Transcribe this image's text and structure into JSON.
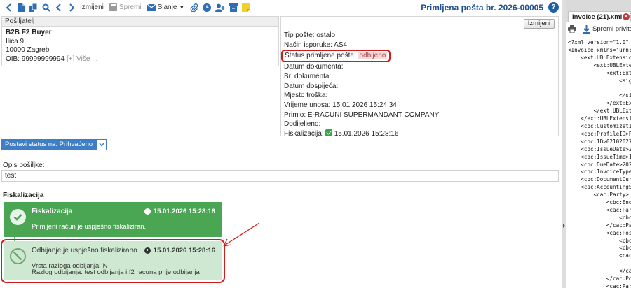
{
  "toolbar": {
    "edit_label": "Izmijeni",
    "save_label": "Spremi",
    "send_label": "Slanje",
    "title": "Primljena pošta br. 2026-00005",
    "help_label": "?"
  },
  "sender": {
    "header": "Pošiljatelj",
    "company": "B2B F2 Buyer",
    "street": "Ilica 9",
    "city": "10000 Zagreb",
    "oib": "OIB: 99999999994",
    "more": "[+] Više ..."
  },
  "info": {
    "edit_button": "Izmijeni",
    "doc_type": "Tip pošte: ostalo",
    "delivery": "Način isporuke: AS4",
    "status_label": "Status primljene pošte:",
    "status_value": "odbijeno",
    "doc_date": "Datum dokumenta:",
    "doc_no": "Br. dokumenta:",
    "due_date": "Datum dospijeća:",
    "cost_place": "Mjesto troška:",
    "entry_time": "Vrijeme unosa: 15.01.2026 15:24:34",
    "received_by": "Primio: E-RACUNI SUPERMANDANT COMPANY",
    "assigned": "Dodijeljeno:",
    "fisk_label": "Fiskalizacija:",
    "fisk_time": "15.01.2026 15:28:16"
  },
  "actions": {
    "set_status": "Postavi status na: Prihvaćeno"
  },
  "description": {
    "label": "Opis pošiljke:",
    "value": "test"
  },
  "fiscalization": {
    "title": "Fiskalizacija",
    "cards": [
      {
        "title": "Fiskalizacija",
        "time": "15.01.2026 15:28:16",
        "line1": "Primljeni račun je uspješno fiskaliziran."
      },
      {
        "title": "Odbijanje je uspješno fiskalizirano",
        "time": "15.01.2026 15:28:16",
        "line1": "Vrsta razloga odbijanja: N",
        "line2": "Razlog odbijanja: test odbijanja i f2 racuna prije odbijanja"
      }
    ]
  },
  "viewer": {
    "tab_label": "invoice (21).xml",
    "tab_close": "×",
    "save_label": "Spremi privitak",
    "xml_lines": [
      "<?xml version=\"1.0\" e",
      "<Invoice xmlns=\"urn:o",
      "    <ext:UBLExtensio",
      "        <ext:UBLExte",
      "            <ext:Ext",
      "                <sig",
      "",
      "                </si",
      "            </ext:Ex",
      "        </ext:UBLExt",
      "    </ext:UBLExtensi",
      "    <cbc:CustomizatI",
      "    <cbc:ProfileID>P",
      "    <cbc:ID>02102027",
      "    <cbc:IssueDate>2",
      "    <cbc:IssueTime>1",
      "    <cbc:DueDate>202",
      "    <cbc:InvoiceType",
      "    <cbc:DocumentCur",
      "    <cac:AccountingS",
      "        <cac:Party>",
      "            <cbc:End",
      "            <cac:Par",
      "                <cbc",
      "            </cac:Pa",
      "            <cac:Pos",
      "                <cbc",
      "                <cbc",
      "                <cac",
      "",
      "                </ca",
      "            </cac:Po",
      "            <cac:Par",
      "                <cbc"
    ]
  },
  "colors": {
    "accent": "#1f4f8f",
    "success": "#4aa652",
    "success_light": "#cfe8d1",
    "annotation": "#d11a1a",
    "button_blue": "#3d7ec5"
  }
}
